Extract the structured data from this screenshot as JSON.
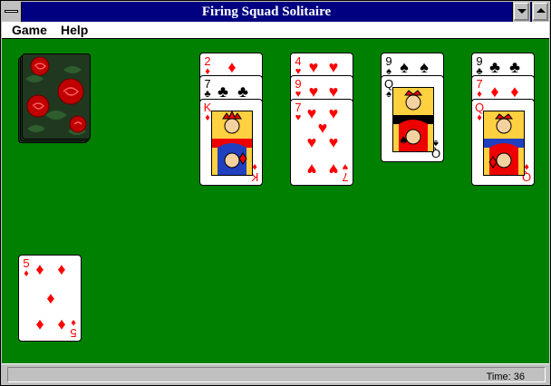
{
  "window": {
    "title": "Firing Squad Solitaire"
  },
  "menu": {
    "game": "Game",
    "help": "Help"
  },
  "status": {
    "time": "Time: 36"
  },
  "cards": {
    "c1": {
      "rank": "2",
      "suit": "♦"
    },
    "c2": {
      "rank": "7",
      "suit": "♣"
    },
    "c3": {
      "rank": "K",
      "suit": "♦"
    },
    "c4": {
      "rank": "4",
      "suit": "♥"
    },
    "c5": {
      "rank": "9",
      "suit": "♥"
    },
    "c6": {
      "rank": "7",
      "suit": "♥"
    },
    "c7": {
      "rank": "9",
      "suit": "♠"
    },
    "c8": {
      "rank": "Q",
      "suit": "♠"
    },
    "c9": {
      "rank": "9",
      "suit": "♣"
    },
    "c10": {
      "rank": "7",
      "suit": "♦"
    },
    "c11": {
      "rank": "Q",
      "suit": "♦"
    },
    "c12": {
      "rank": "5",
      "suit": "♦"
    }
  },
  "colors": {
    "felt": "#008000",
    "titlebar": "#000080",
    "red": "#ff0000"
  }
}
